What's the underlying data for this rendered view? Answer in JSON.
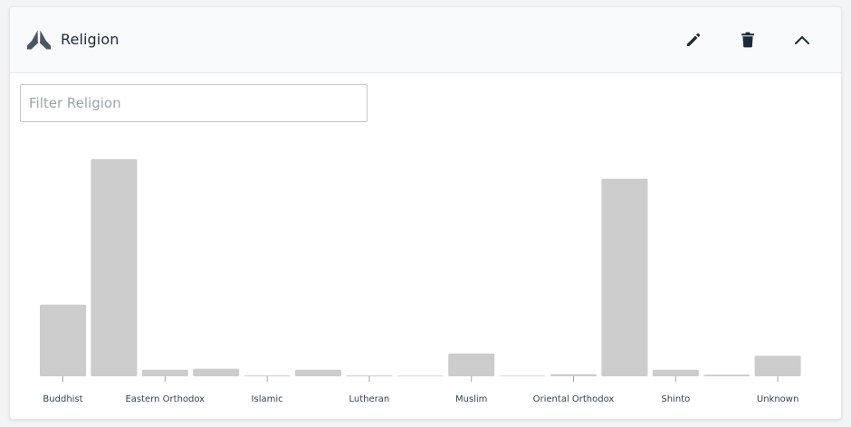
{
  "panel": {
    "title": "Religion",
    "header_icon": "praying-hands-icon",
    "actions": [
      {
        "name": "edit",
        "icon": "pencil-icon"
      },
      {
        "name": "delete",
        "icon": "trash-icon"
      },
      {
        "name": "collapse",
        "icon": "chevron-up-icon"
      }
    ]
  },
  "filter": {
    "placeholder": "Filter Religion",
    "value": ""
  },
  "colors": {
    "bar": "#cccccc",
    "tick": "#9ca3af",
    "header_icon": "#4b5563",
    "action_icon": "#1f2937"
  },
  "chart_data": {
    "type": "bar",
    "title": "",
    "xlabel": "",
    "ylabel": "",
    "ylim": [
      0,
      100
    ],
    "grid": false,
    "legend": "none",
    "categories": [
      "Buddhist",
      "",
      "Eastern Orthodox",
      "",
      "Islamic",
      "",
      "Lutheran",
      "",
      "Muslim",
      "",
      "Oriental Orthodox",
      "",
      "Shinto",
      "",
      "Unknown"
    ],
    "values": [
      33,
      100,
      3,
      3.5,
      0.4,
      3,
      0.4,
      0,
      10.5,
      0,
      1,
      91,
      3,
      0.8,
      9.5
    ]
  }
}
